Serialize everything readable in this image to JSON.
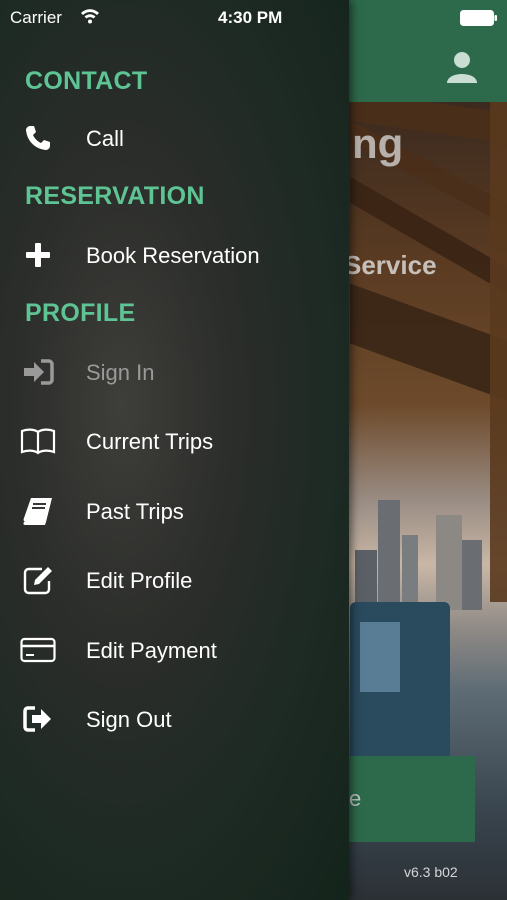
{
  "status_bar": {
    "carrier": "Carrier",
    "time": "4:30 PM"
  },
  "background": {
    "title_fragment": "ng",
    "subtitle_fragment": "Service",
    "button_fragment": "e",
    "version": "v6.3  b02",
    "header_color": "#2d6a4c"
  },
  "drawer": {
    "accent_color": "#5ec494",
    "sections": [
      {
        "header": "CONTACT",
        "items": [
          {
            "label": "Call",
            "icon": "phone-icon",
            "enabled": true
          }
        ]
      },
      {
        "header": "RESERVATION",
        "items": [
          {
            "label": "Book Reservation",
            "icon": "plus-icon",
            "enabled": true
          }
        ]
      },
      {
        "header": "PROFILE",
        "items": [
          {
            "label": "Sign In",
            "icon": "sign-in-icon",
            "enabled": false
          },
          {
            "label": "Current Trips",
            "icon": "open-book-icon",
            "enabled": true
          },
          {
            "label": "Past Trips",
            "icon": "closed-book-icon",
            "enabled": true
          },
          {
            "label": "Edit Profile",
            "icon": "edit-icon",
            "enabled": true
          },
          {
            "label": "Edit Payment",
            "icon": "credit-card-icon",
            "enabled": true
          },
          {
            "label": "Sign Out",
            "icon": "sign-out-icon",
            "enabled": true
          }
        ]
      }
    ]
  }
}
